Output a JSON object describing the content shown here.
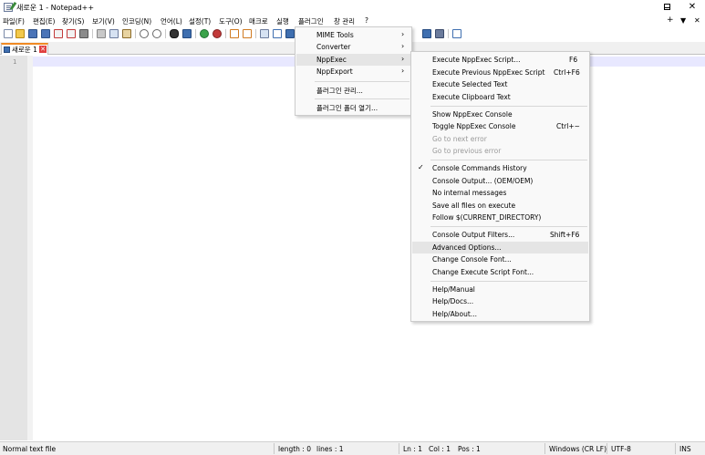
{
  "window": {
    "title": "새로운 1 - Notepad++",
    "controls": {
      "minimize": "minimize",
      "maximize": "maximize",
      "close": "✕"
    }
  },
  "menubar": {
    "items": [
      "파일(F)",
      "편집(E)",
      "찾기(S)",
      "보기(V)",
      "인코딩(N)",
      "언어(L)",
      "설정(T)",
      "도구(O)",
      "매크로",
      "실행",
      "플러그인",
      "창 관리",
      "?"
    ],
    "right": [
      "+",
      "▼",
      "✕"
    ]
  },
  "toolbar": {
    "icons": [
      "new-file-icon",
      "open-file-icon",
      "save-icon",
      "save-all-icon",
      "close-icon",
      "close-all-icon",
      "print-icon",
      "cut-icon",
      "copy-icon",
      "paste-icon",
      "undo-icon",
      "redo-icon",
      "find-icon",
      "replace-icon",
      "zoom-in-icon",
      "zoom-out-icon",
      "sync-v-icon",
      "sync-h-icon",
      "word-wrap-icon",
      "all-chars-icon",
      "indent-guide-icon",
      "macro-record-icon",
      "macro-play-icon",
      "macro-save-icon",
      "doc-map-icon"
    ]
  },
  "tabs": [
    {
      "label": "새로운 1",
      "close": "✕"
    }
  ],
  "editor": {
    "line_numbers": [
      "1"
    ]
  },
  "plugins_menu": {
    "items": [
      {
        "label": "MIME Tools",
        "arrow": "›"
      },
      {
        "label": "Converter",
        "arrow": "›"
      },
      {
        "label": "NppExec",
        "arrow": "›"
      },
      {
        "label": "NppExport",
        "arrow": "›"
      },
      {
        "label": "플러그인 관리..."
      },
      {
        "label": "플러그인 폴더 열기..."
      }
    ]
  },
  "nppexec_menu": {
    "items": [
      {
        "label": "Execute NppExec Script...",
        "shortcut": "F6"
      },
      {
        "label": "Execute Previous NppExec Script",
        "shortcut": "Ctrl+F6"
      },
      {
        "label": "Execute Selected Text",
        "shortcut": ""
      },
      {
        "label": "Execute Clipboard Text",
        "shortcut": ""
      },
      {
        "label": "Show NppExec Console",
        "shortcut": ""
      },
      {
        "label": "Toggle NppExec Console",
        "shortcut": "Ctrl+~"
      },
      {
        "label": "Go to next error",
        "shortcut": ""
      },
      {
        "label": "Go to previous error",
        "shortcut": ""
      },
      {
        "label": "Console Commands History",
        "shortcut": "",
        "check": "✓"
      },
      {
        "label": "Console Output... (OEM/OEM)",
        "shortcut": ""
      },
      {
        "label": "No internal messages",
        "shortcut": ""
      },
      {
        "label": "Save all files on execute",
        "shortcut": ""
      },
      {
        "label": "Follow $(CURRENT_DIRECTORY)",
        "shortcut": ""
      },
      {
        "label": "Console Output Filters...",
        "shortcut": "Shift+F6"
      },
      {
        "label": "Advanced Options...",
        "shortcut": ""
      },
      {
        "label": "Change Console Font...",
        "shortcut": ""
      },
      {
        "label": "Change Execute Script Font...",
        "shortcut": ""
      },
      {
        "label": "Help/Manual",
        "shortcut": ""
      },
      {
        "label": "Help/Docs...",
        "shortcut": ""
      },
      {
        "label": "Help/About...",
        "shortcut": ""
      }
    ]
  },
  "statusbar": {
    "file_type": "Normal text file",
    "length": "length : 0",
    "lines": "lines : 1",
    "ln": "Ln : 1",
    "col": "Col : 1",
    "pos": "Pos : 1",
    "eol": "Windows (CR LF)",
    "encoding": "UTF-8",
    "mode": "INS"
  },
  "colors": {
    "tab_accent": "#f08a24",
    "caret_line": "#e8e8ff",
    "menu_highlight": "#e5e5e5"
  }
}
